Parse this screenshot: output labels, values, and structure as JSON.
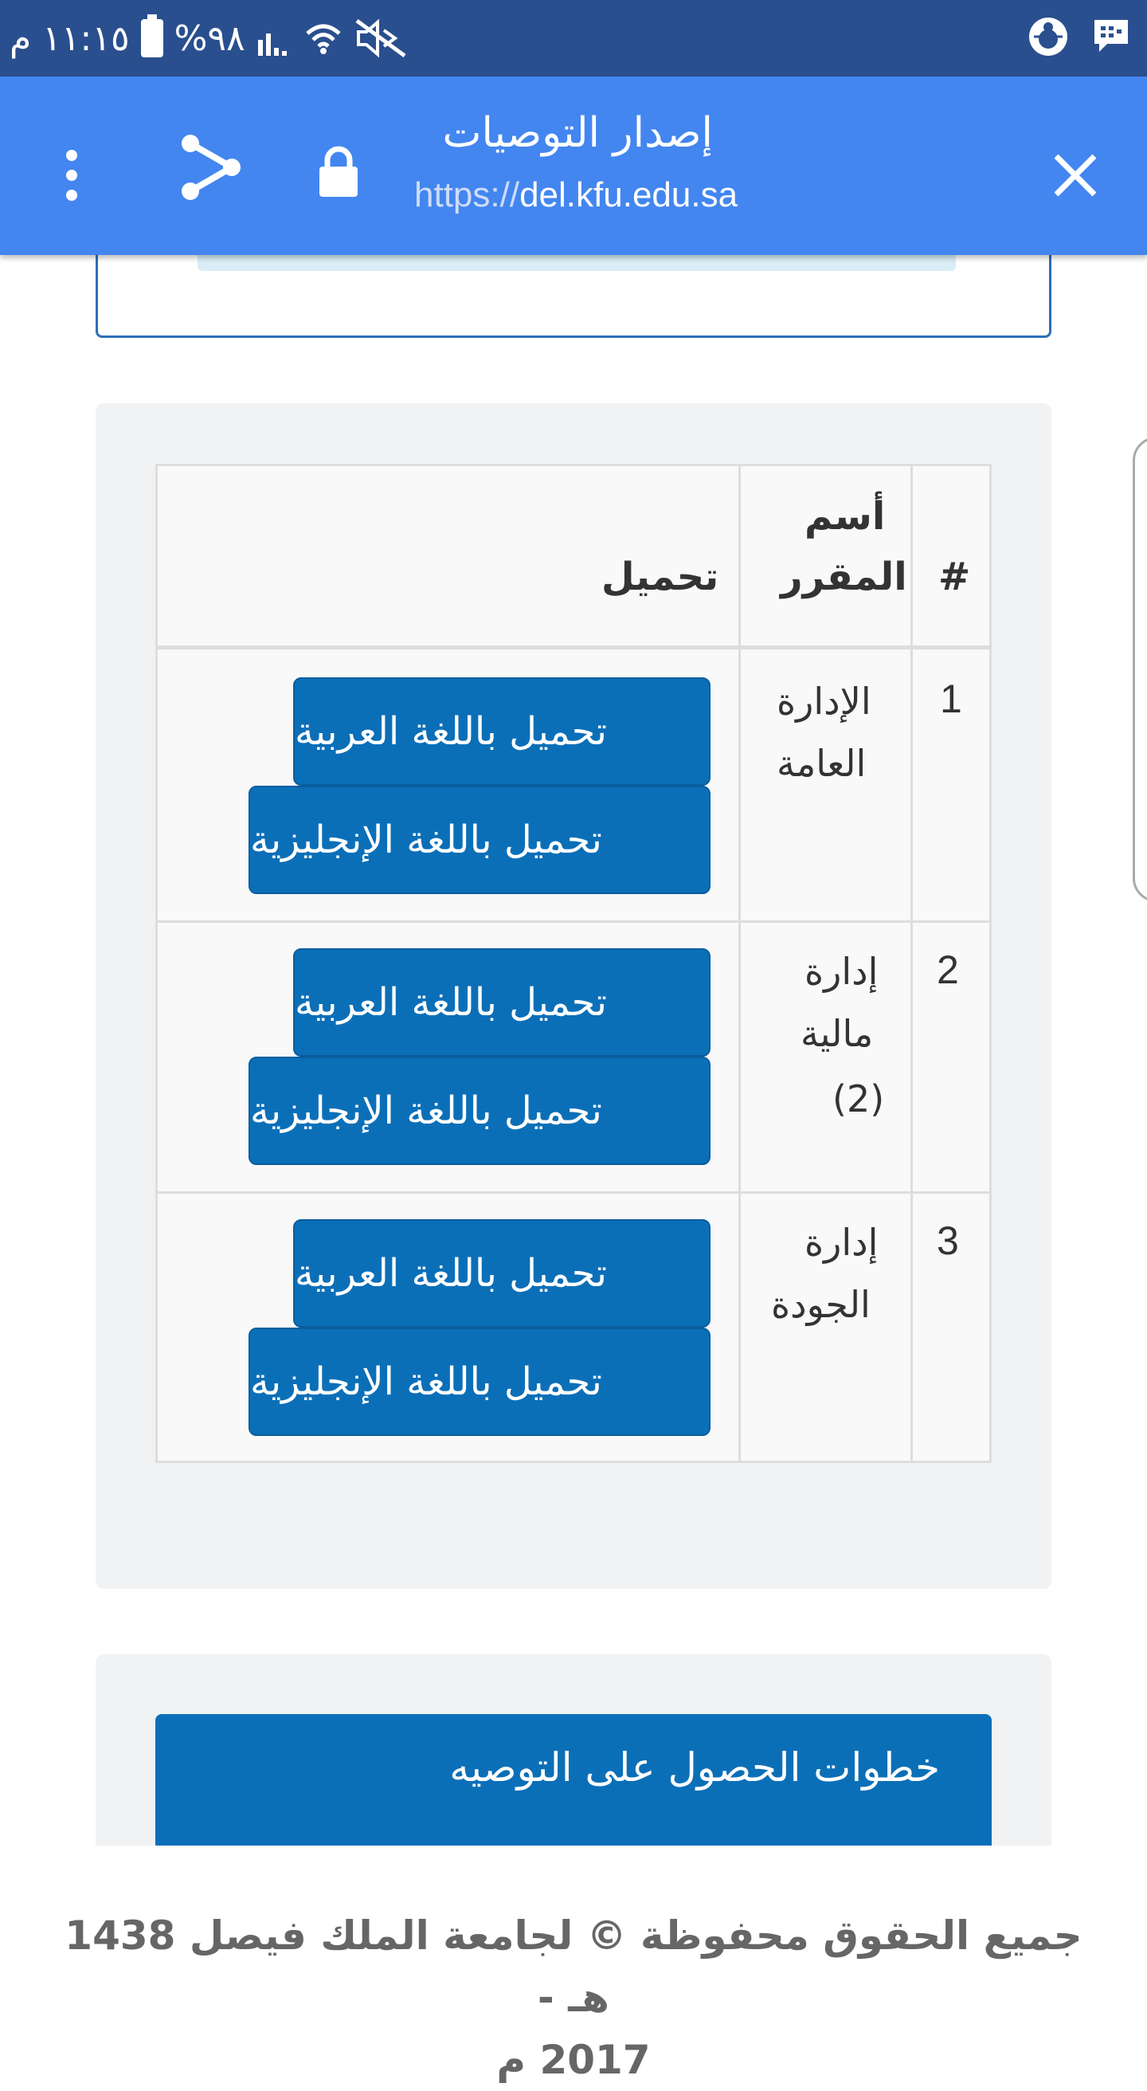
{
  "status_bar": {
    "time": "١١:١٥ م",
    "battery": "%٩٨"
  },
  "app_bar": {
    "title": "إصدار التوصيات",
    "url_scheme": "https://",
    "url_host": "del.kfu.edu.sa",
    "icons": [
      "close-icon",
      "lock-icon",
      "share-icon",
      "more-vert-icon"
    ]
  },
  "table": {
    "headers": {
      "num": "#",
      "course_line1": "أسم",
      "course_line2": "المقرر",
      "download": "تحميل"
    },
    "rows": [
      {
        "num": "1",
        "course_lines": [
          "الإدارة",
          "العامة"
        ],
        "btn_ar": "تحميل باللغة العربية",
        "btn_en": "تحميل باللغة الإنجليزية"
      },
      {
        "num": "2",
        "course_lines": [
          "إدارة",
          "مالية",
          "(2)"
        ],
        "btn_ar": "تحميل باللغة العربية",
        "btn_en": "تحميل باللغة الإنجليزية"
      },
      {
        "num": "3",
        "course_lines": [
          "إدارة",
          "الجودة"
        ],
        "btn_ar": "تحميل باللغة العربية",
        "btn_en": "تحميل باللغة الإنجليزية"
      }
    ]
  },
  "steps_button": "خطوات الحصول على التوصيه",
  "footer": {
    "line1": "جميع الحقوق محفوظة © لجامعة الملك فيصل 1438 هـ -",
    "line2": "2017 م"
  },
  "colors": {
    "status_bar": "#2a4f8f",
    "app_bar": "#4386f0",
    "button": "#0b6fb8",
    "well": "#f0f2f3"
  }
}
